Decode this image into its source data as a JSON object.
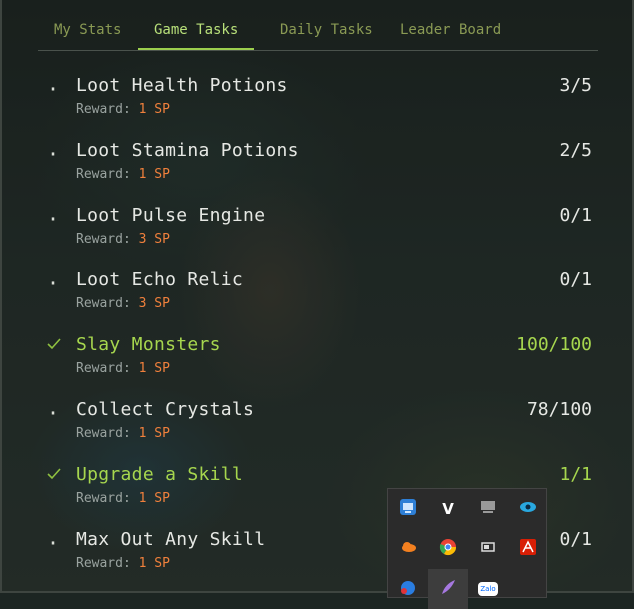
{
  "tabs": [
    {
      "label": "My Stats",
      "active": false
    },
    {
      "label": "Game Tasks",
      "active": true
    },
    {
      "label": "Daily Tasks",
      "active": false
    },
    {
      "label": "Leader Board",
      "active": false
    }
  ],
  "reward_prefix": "Reward: ",
  "tasks": [
    {
      "name": "Loot Health Potions",
      "reward": "1 SP",
      "progress": "3/5",
      "completed": false
    },
    {
      "name": "Loot Stamina Potions",
      "reward": "1 SP",
      "progress": "2/5",
      "completed": false
    },
    {
      "name": "Loot Pulse Engine",
      "reward": "3 SP",
      "progress": "0/1",
      "completed": false
    },
    {
      "name": "Loot Echo Relic",
      "reward": "3 SP",
      "progress": "0/1",
      "completed": false
    },
    {
      "name": "Slay Monsters",
      "reward": "1 SP",
      "progress": "100/100",
      "completed": true
    },
    {
      "name": "Collect Crystals",
      "reward": "1 SP",
      "progress": "78/100",
      "completed": false
    },
    {
      "name": "Upgrade a Skill",
      "reward": "1 SP",
      "progress": "1/1",
      "completed": true
    },
    {
      "name": "Max Out Any Skill",
      "reward": "1 SP",
      "progress": "0/1",
      "completed": false
    }
  ],
  "colors": {
    "accent_green": "#a6d64e",
    "tab_inactive": "#8a9a54",
    "reward_value": "#f0803c"
  },
  "tray": {
    "icons": [
      {
        "name": "network-app-icon",
        "color": "#2e7fd6"
      },
      {
        "name": "v-app-icon",
        "text": "V",
        "color": "#ffffff"
      },
      {
        "name": "display-icon",
        "color": "#9a9a9a"
      },
      {
        "name": "eye-app-icon",
        "color": "#29a8e0"
      },
      {
        "name": "cloud-icon",
        "color": "#f38020"
      },
      {
        "name": "chrome-icon",
        "color": "#e94235"
      },
      {
        "name": "battery-icon",
        "color": "#dddddd"
      },
      {
        "name": "adobe-acrobat-icon",
        "color": "#d81e05"
      },
      {
        "name": "notification-badge-icon",
        "color": "#2a7de1"
      },
      {
        "name": "feather-app-icon",
        "color": "#a678e0"
      },
      {
        "name": "zalo-icon",
        "text": "Zalo",
        "color": "#ffffff"
      }
    ]
  }
}
